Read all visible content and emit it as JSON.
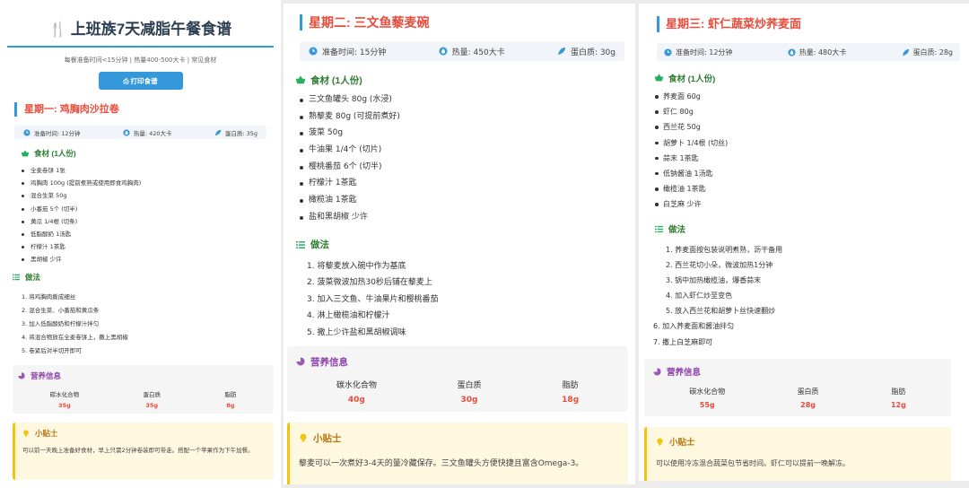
{
  "header": {
    "title": "上班族7天减脂午餐食谱",
    "subtitle": "每餐准备时间<15分钟 | 热量400-500大卡 | 常见食材",
    "print_label": "打印食谱"
  },
  "days": [
    {
      "title": "星期一: 鸡胸肉沙拉卷",
      "prep": "准备时间: 12分钟",
      "calories": "热量: 420大卡",
      "protein": "蛋白质: 35g",
      "ingredients_title": "食材 (1人份)",
      "ingredients": [
        "全麦卷饼 1张",
        "鸡胸肉 100g (提前煮熟或使用即食鸡胸肉)",
        "混合生菜 50g",
        "小番茄 5个 (切半)",
        "黄瓜 1/4根 (切条)",
        "低脂酸奶 1汤匙",
        "柠檬汁 1茶匙",
        "黑胡椒 少许"
      ],
      "steps_title": "做法",
      "steps": [
        "1. 将鸡胸肉撕成细丝",
        "2. 混合生菜、小番茄和黄瓜条",
        "3. 加入低脂酸奶和柠檬汁拌匀",
        "4. 将混合物放在全麦卷饼上，撒上黑胡椒",
        "5. 卷紧后对半切开即可"
      ],
      "nutrition_title": "营养信息",
      "nutrition": [
        {
          "label": "碳水化合物",
          "value": "35g"
        },
        {
          "label": "蛋白质",
          "value": "35g"
        },
        {
          "label": "脂肪",
          "value": "8g"
        }
      ],
      "tip_title": "小贴士",
      "tip": "可以前一天晚上准备好食材，早上只需2分钟卷装即可带走。搭配一个苹果作为下午加餐。"
    },
    {
      "title": "星期二: 三文鱼藜麦碗",
      "prep": "准备时间: 15分钟",
      "calories": "热量: 450大卡",
      "protein": "蛋白质: 30g",
      "ingredients_title": "食材 (1人份)",
      "ingredients": [
        "三文鱼罐头 80g (水浸)",
        "熟藜麦 80g (可提前煮好)",
        "菠菜 50g",
        "牛油果 1/4个 (切片)",
        "樱桃番茄 6个 (切半)",
        "柠檬汁 1茶匙",
        "橄榄油 1茶匙",
        "盐和黑胡椒 少许"
      ],
      "steps_title": "做法",
      "steps": [
        "1. 将藜麦放入碗中作为基底",
        "2. 菠菜微波加热30秒后铺在藜麦上",
        "3. 加入三文鱼、牛油果片和樱桃番茄",
        "4. 淋上橄榄油和柠檬汁",
        "5. 撒上少许盐和黑胡椒调味"
      ],
      "nutrition_title": "营养信息",
      "nutrition": [
        {
          "label": "碳水化合物",
          "value": "40g"
        },
        {
          "label": "蛋白质",
          "value": "30g"
        },
        {
          "label": "脂肪",
          "value": "18g"
        }
      ],
      "tip_title": "小贴士",
      "tip": "藜麦可以一次煮好3-4天的量冷藏保存。三文鱼罐头方便快捷且富含Omega-3。"
    },
    {
      "title": "星期三: 虾仁蔬菜炒荞麦面",
      "prep": "准备时间: 12分钟",
      "calories": "热量: 480大卡",
      "protein": "蛋白质: 28g",
      "ingredients_title": "食材 (1人份)",
      "ingredients": [
        "荞麦面 60g",
        "虾仁 80g",
        "西兰花 50g",
        "胡萝卜 1/4根 (切丝)",
        "蒜末 1茶匙",
        "低钠酱油 1汤匙",
        "橄榄油 1茶匙",
        "白芝麻 少许"
      ],
      "steps_title": "做法",
      "steps": [
        "1. 荞麦面按包装说明煮熟，沥干备用",
        "2. 西兰花切小朵，微波加热1分钟",
        "3. 锅中加热橄榄油，爆香蒜末",
        "4. 加入虾仁炒至变色",
        "5. 放入西兰花和胡萝卜丝快速翻炒",
        "6. 加入荞麦面和酱油拌匀",
        "7. 撒上白芝麻即可"
      ],
      "nutrition_title": "营养信息",
      "nutrition": [
        {
          "label": "碳水化合物",
          "value": "55g"
        },
        {
          "label": "蛋白质",
          "value": "28g"
        },
        {
          "label": "脂肪",
          "value": "12g"
        }
      ],
      "tip_title": "小贴士",
      "tip": "可以使用冷冻混合蔬菜包节省时间。虾仁可以提前一晚解冻。"
    }
  ]
}
